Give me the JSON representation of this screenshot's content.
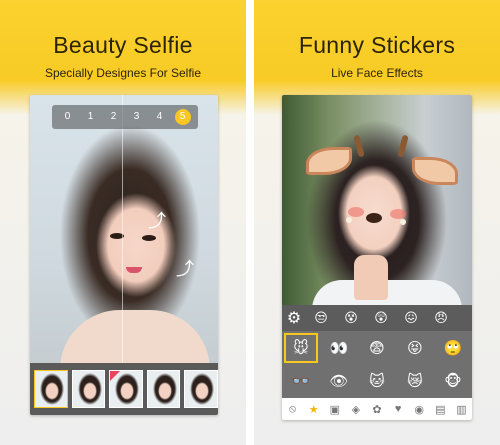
{
  "left_panel": {
    "title": "Beauty Selfie",
    "subtitle": "Specially Designes For Selfie",
    "beauty_levels": [
      "0",
      "1",
      "2",
      "3",
      "4",
      "5"
    ],
    "active_level": "5",
    "filters": [
      "filter-1",
      "filter-2",
      "filter-3",
      "filter-4",
      "filter-5"
    ]
  },
  "right_panel": {
    "title": "Funny Stickers",
    "subtitle": "Live Face Effects",
    "settings_icon": "gear-icon",
    "sticker_rows": [
      [
        "sticker-1",
        "sticker-2",
        "sticker-3",
        "sticker-4",
        "sticker-5"
      ],
      [
        "sticker-6",
        "sticker-7",
        "sticker-8",
        "sticker-9",
        "sticker-10"
      ]
    ],
    "category_tabs": [
      "none-icon",
      "star-icon",
      "cat-1",
      "cat-2",
      "cat-3",
      "cat-4",
      "cat-5",
      "cat-6",
      "cat-7"
    ]
  },
  "colors": {
    "accent": "#f9c623",
    "banner": "#fbd22f",
    "text_dark": "#2b2308"
  }
}
